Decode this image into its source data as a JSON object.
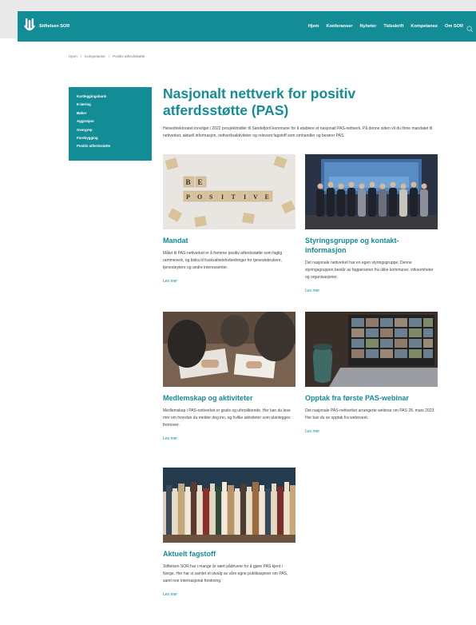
{
  "header": {
    "logo_text": "Stiftelsen SOR",
    "nav": [
      "Hjem",
      "Konferanser",
      "Nyheter",
      "Tidsskrift",
      "Kompetanse",
      "Om SOR"
    ]
  },
  "breadcrumb": [
    "Hjem",
    "Kompetanse",
    "Positiv atferdsstøtte"
  ],
  "sidebar": {
    "items": [
      "Kartleggingsbank",
      "E-læring",
      "Bøker",
      "Aggresjon",
      "Overgrep",
      "Forebygging",
      "Positiv atferdsstøtte"
    ]
  },
  "main": {
    "title": "Nasjonalt nettverk for positiv atferdsstøtte (PAS)",
    "intro": "Helsedirektoratet innvilget i 2022 prosjektmidler til Sandefjord kommune for å etablere et nasjonalt PAS-nettverk. På denne siden vil du finne mandatet til nettverket, aktuell informasjon, nettverksaktiviteter og relevant fagstoff som omhandler og berører PAS.",
    "cards": [
      {
        "title": "Mandat",
        "text": "Målet til PAS-nettverket er å fremme positiv atferdsstøtte som faglig rammeverk, og bidra til livskvalitetsforbedringer for tjenestebrukere, tjenesteytere og andre interessenter.",
        "link": "Les mer",
        "image": "scrabble-tiles-image",
        "image_words": [
          "BE",
          "POSITIVE"
        ]
      },
      {
        "title": "Styringsgruppe og kontakt-informasjon",
        "text": "Det nasjonale nettverket har en egen styringsgruppe. Denne styringsgruppen består av fagpersoner fra ulike kommuner, virksomheter og organisasjoner.",
        "link": "Les mer",
        "image": "group-photo-image"
      },
      {
        "title": "Medlemskap og aktiviteter",
        "text": "Medlemskap i PAS-nettverket er gratis og uforpliktende. Her kan du lese mer om hvordan du melder deg inn, og hvilke aktiviteter som planlegges fremover.",
        "link": "Les mer",
        "image": "meeting-table-image"
      },
      {
        "title": "Opptak fra første PAS-webinar",
        "text": "Det nasjonale PAS-nettverket arrangerte webinar om PAS 28. mars 2023. Her kan du se opptak fra webinaret.",
        "link": "Les mer",
        "image": "video-call-laptop-image"
      },
      {
        "title": "Aktuelt fagstoff",
        "text": "Stiftelsen SOR har i mange år vært pådrivere for å gjøre PAS kjent i Norge. Her har vi samlet et utvalg av våre egne publikasjoner om PAS, samt noe internasjonal forskning.",
        "link": "Les mer",
        "image": "bookshelf-image"
      }
    ]
  },
  "colors": {
    "brand": "#138c96",
    "text": "#444444"
  }
}
